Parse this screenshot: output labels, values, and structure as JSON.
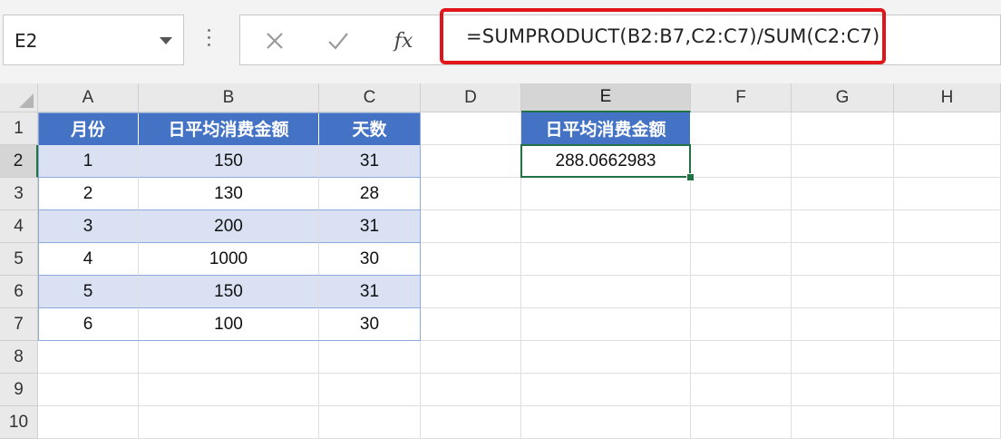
{
  "formula_bar": {
    "name_box": "E2",
    "formula": "=SUMPRODUCT(B2:B7,C2:C7)/SUM(C2:C7)",
    "fx_label": "fx"
  },
  "columns": [
    "A",
    "B",
    "C",
    "D",
    "E",
    "F",
    "G",
    "H"
  ],
  "rows": [
    "1",
    "2",
    "3",
    "4",
    "5",
    "6",
    "7",
    "8",
    "9",
    "10"
  ],
  "table": {
    "headers": [
      "月份",
      "日平均消费金额",
      "天数"
    ],
    "data": [
      [
        "1",
        "150",
        "31"
      ],
      [
        "2",
        "130",
        "28"
      ],
      [
        "3",
        "200",
        "31"
      ],
      [
        "4",
        "1000",
        "30"
      ],
      [
        "5",
        "150",
        "31"
      ],
      [
        "6",
        "100",
        "30"
      ]
    ]
  },
  "result": {
    "header": "日平均消费金额",
    "value": "288.0662983"
  },
  "colors": {
    "header_fill": "#4472c4",
    "band_fill": "#d9e1f2",
    "selection": "#217346",
    "highlight": "#e0161b"
  },
  "icons": {
    "cancel": "close-icon",
    "enter": "check-icon",
    "function": "fx-icon"
  }
}
